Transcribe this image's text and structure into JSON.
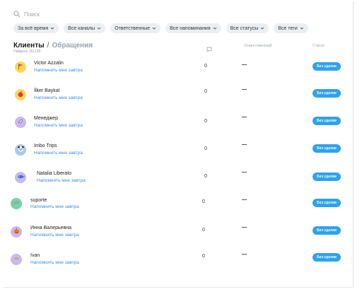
{
  "search": {
    "placeholder": "Поиск"
  },
  "filters": [
    {
      "label": "За всё время"
    },
    {
      "label": "Все каналы"
    },
    {
      "label": "Ответственные"
    },
    {
      "label": "Все напоминания"
    },
    {
      "label": "Все статусы"
    },
    {
      "label": "Все теги"
    }
  ],
  "tabs": {
    "active": "Клиенты",
    "separator": "/",
    "inactive": "Обращения"
  },
  "found_text": "Найдено 161128",
  "columns": {
    "responsible": "Ответственный",
    "status": "Статус",
    "messages_icon": "chat-bubble-icon"
  },
  "rows": [
    {
      "name": "Victor Azzalin",
      "remind": "Напомнить мне завтра",
      "count": "0",
      "status": "Без сделки",
      "avatar_icon": "flag-icon",
      "avatar_bg": "#fbd85a"
    },
    {
      "name": "İlker Baykal",
      "remind": "Напомнить мне завтра",
      "count": "0",
      "status": "Без сделки",
      "avatar_icon": "apple-icon",
      "avatar_bg": "#fbd85a"
    },
    {
      "name": "Менеджер",
      "remind": "Напомнить мне завтра",
      "count": "0",
      "status": "Без сделки",
      "avatar_icon": "rocket-icon",
      "avatar_bg": "#c9b8f2"
    },
    {
      "name": "Imbo Trips",
      "remind": "Напомнить мне завтра",
      "count": "0",
      "status": "Без сделки",
      "avatar_icon": "panda-icon",
      "avatar_bg": "#a9c7f3"
    },
    {
      "name": "Natalia Liberato",
      "remind": "Напомнить мне завтра",
      "count": "0",
      "status": "Без сделки",
      "avatar_icon": "whale-icon",
      "avatar_bg": "#c9b8f2"
    },
    {
      "name": "suporte",
      "remind": "Напомнить мне завтра",
      "count": "0",
      "status": "Без сделки",
      "avatar_icon": "cloud-icon",
      "avatar_bg": "#6fd4a6"
    },
    {
      "name": "Инна Валерьевна",
      "remind": "Напомнить мне завтра",
      "count": "0",
      "status": "Без сделки",
      "avatar_icon": "pumpkin-icon",
      "avatar_bg": "#c9b8f2"
    },
    {
      "name": "Ivan",
      "remind": "Напомнить мне завтра",
      "count": "0",
      "status": "Без сделки",
      "avatar_icon": "taco-icon",
      "avatar_bg": "#c9b8f2"
    }
  ],
  "colors": {
    "accent": "#2ea2ee",
    "link": "#3b8ee6",
    "chip_bg": "#eceff2"
  }
}
